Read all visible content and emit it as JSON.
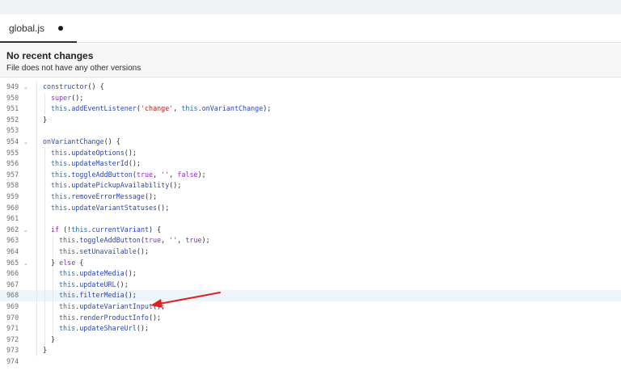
{
  "tab": {
    "label": "global.js",
    "modified": true
  },
  "info": {
    "title": "No recent changes",
    "subtitle": "File does not have any other versions"
  },
  "colors": {
    "arrow": "#e02020",
    "highlight": "#eef4fb",
    "keyword": "#8f2acf",
    "function": "#2a46b8",
    "string": "#b5221f"
  },
  "editor": {
    "highlighted_line": 968,
    "lines": [
      {
        "n": "949",
        "fold": true,
        "indent": 1,
        "tokens": [
          [
            "fn",
            "constructor"
          ],
          [
            "p",
            "() {"
          ]
        ]
      },
      {
        "n": "950",
        "fold": false,
        "indent": 2,
        "tokens": [
          [
            "kw",
            "super"
          ],
          [
            "p",
            "();"
          ]
        ]
      },
      {
        "n": "951",
        "fold": false,
        "indent": 2,
        "tokens": [
          [
            "this",
            "this"
          ],
          [
            "p",
            "."
          ],
          [
            "fn",
            "addEventListener"
          ],
          [
            "p",
            "("
          ],
          [
            "str",
            "'change'"
          ],
          [
            "p",
            ", "
          ],
          [
            "this",
            "this"
          ],
          [
            "p",
            "."
          ],
          [
            "fn",
            "onVariantChange"
          ],
          [
            "p",
            ");"
          ]
        ]
      },
      {
        "n": "952",
        "fold": false,
        "indent": 1,
        "tokens": [
          [
            "p",
            "}"
          ]
        ]
      },
      {
        "n": "953",
        "fold": false,
        "indent": 0,
        "tokens": []
      },
      {
        "n": "954",
        "fold": true,
        "indent": 1,
        "tokens": [
          [
            "fn",
            "onVariantChange"
          ],
          [
            "p",
            "() {"
          ]
        ]
      },
      {
        "n": "955",
        "fold": false,
        "indent": 2,
        "tokens": [
          [
            "this",
            "this"
          ],
          [
            "p",
            "."
          ],
          [
            "fn",
            "updateOptions"
          ],
          [
            "p",
            "();"
          ]
        ]
      },
      {
        "n": "956",
        "fold": false,
        "indent": 2,
        "tokens": [
          [
            "this",
            "this"
          ],
          [
            "p",
            "."
          ],
          [
            "fn",
            "updateMasterId"
          ],
          [
            "p",
            "();"
          ]
        ]
      },
      {
        "n": "957",
        "fold": false,
        "indent": 2,
        "tokens": [
          [
            "this",
            "this"
          ],
          [
            "p",
            "."
          ],
          [
            "fn",
            "toggleAddButton"
          ],
          [
            "p",
            "("
          ],
          [
            "kw",
            "true"
          ],
          [
            "p",
            ", "
          ],
          [
            "str",
            "''"
          ],
          [
            "p",
            ", "
          ],
          [
            "kw",
            "false"
          ],
          [
            "p",
            ");"
          ]
        ]
      },
      {
        "n": "958",
        "fold": false,
        "indent": 2,
        "tokens": [
          [
            "this",
            "this"
          ],
          [
            "p",
            "."
          ],
          [
            "fn",
            "updatePickupAvailability"
          ],
          [
            "p",
            "();"
          ]
        ]
      },
      {
        "n": "959",
        "fold": false,
        "indent": 2,
        "tokens": [
          [
            "this",
            "this"
          ],
          [
            "p",
            "."
          ],
          [
            "fn",
            "removeErrorMessage"
          ],
          [
            "p",
            "();"
          ]
        ]
      },
      {
        "n": "960",
        "fold": false,
        "indent": 2,
        "tokens": [
          [
            "this",
            "this"
          ],
          [
            "p",
            "."
          ],
          [
            "fn",
            "updateVariantStatuses"
          ],
          [
            "p",
            "();"
          ]
        ]
      },
      {
        "n": "961",
        "fold": false,
        "indent": 0,
        "tokens": []
      },
      {
        "n": "962",
        "fold": true,
        "indent": 2,
        "tokens": [
          [
            "kw",
            "if"
          ],
          [
            "p",
            " (!"
          ],
          [
            "this",
            "this"
          ],
          [
            "p",
            "."
          ],
          [
            "fn",
            "currentVariant"
          ],
          [
            "p",
            ") {"
          ]
        ]
      },
      {
        "n": "963",
        "fold": false,
        "indent": 3,
        "tokens": [
          [
            "this",
            "this"
          ],
          [
            "p",
            "."
          ],
          [
            "fn",
            "toggleAddButton"
          ],
          [
            "p",
            "("
          ],
          [
            "kw",
            "true"
          ],
          [
            "p",
            ", "
          ],
          [
            "str",
            "''"
          ],
          [
            "p",
            ", "
          ],
          [
            "kw",
            "true"
          ],
          [
            "p",
            ");"
          ]
        ]
      },
      {
        "n": "964",
        "fold": false,
        "indent": 3,
        "tokens": [
          [
            "this",
            "this"
          ],
          [
            "p",
            "."
          ],
          [
            "fn",
            "setUnavailable"
          ],
          [
            "p",
            "();"
          ]
        ]
      },
      {
        "n": "965",
        "fold": true,
        "indent": 2,
        "tokens": [
          [
            "p",
            "} "
          ],
          [
            "kw",
            "else"
          ],
          [
            "p",
            " {"
          ]
        ]
      },
      {
        "n": "966",
        "fold": false,
        "indent": 3,
        "tokens": [
          [
            "this",
            "this"
          ],
          [
            "p",
            "."
          ],
          [
            "fn",
            "updateMedia"
          ],
          [
            "p",
            "();"
          ]
        ]
      },
      {
        "n": "967",
        "fold": false,
        "indent": 3,
        "tokens": [
          [
            "this",
            "this"
          ],
          [
            "p",
            "."
          ],
          [
            "fn",
            "updateURL"
          ],
          [
            "p",
            "();"
          ]
        ]
      },
      {
        "n": "968",
        "fold": false,
        "indent": 3,
        "tokens": [
          [
            "this",
            "this"
          ],
          [
            "p",
            "."
          ],
          [
            "fn",
            "filterMedia"
          ],
          [
            "p",
            "();"
          ]
        ]
      },
      {
        "n": "969",
        "fold": false,
        "indent": 3,
        "tokens": [
          [
            "this",
            "this"
          ],
          [
            "p",
            "."
          ],
          [
            "fn",
            "updateVariantInput"
          ],
          [
            "p",
            "();"
          ]
        ]
      },
      {
        "n": "970",
        "fold": false,
        "indent": 3,
        "tokens": [
          [
            "this",
            "this"
          ],
          [
            "p",
            "."
          ],
          [
            "fn",
            "renderProductInfo"
          ],
          [
            "p",
            "();"
          ]
        ]
      },
      {
        "n": "971",
        "fold": false,
        "indent": 3,
        "tokens": [
          [
            "this",
            "this"
          ],
          [
            "p",
            "."
          ],
          [
            "fn",
            "updateShareUrl"
          ],
          [
            "p",
            "();"
          ]
        ]
      },
      {
        "n": "972",
        "fold": false,
        "indent": 2,
        "tokens": [
          [
            "p",
            "}"
          ]
        ]
      },
      {
        "n": "973",
        "fold": false,
        "indent": 1,
        "tokens": [
          [
            "p",
            "}"
          ]
        ]
      },
      {
        "n": "974",
        "fold": false,
        "indent": 0,
        "tokens": []
      }
    ]
  }
}
